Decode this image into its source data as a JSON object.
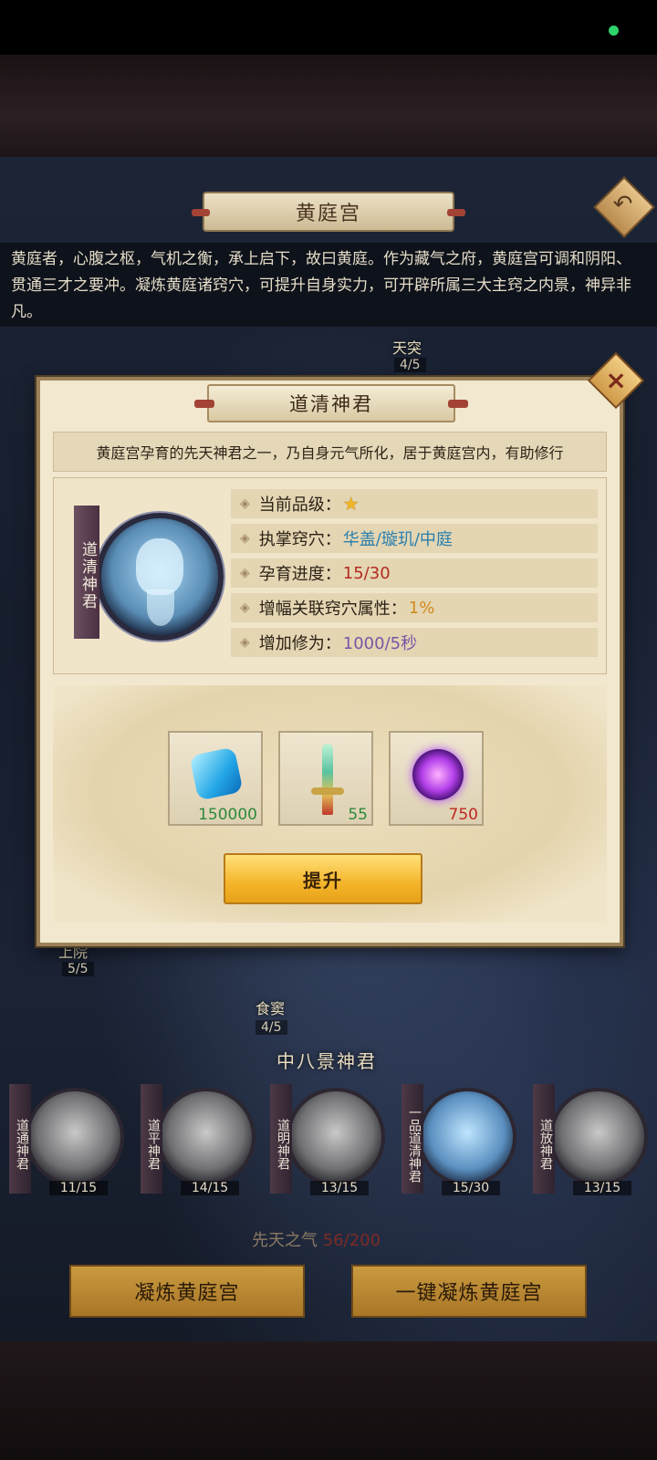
{
  "page": {
    "title": "黄庭宫",
    "description": "黄庭者，心腹之枢，气机之衡，承上启下，故曰黄庭。作为藏气之府，黄庭宫可调和阴阳、贯通三才之要冲。凝炼黄庭诸窍穴，可提升自身实力，可开辟所属三大主窍之内景，神异非凡。"
  },
  "background_nodes": [
    {
      "label": "天突",
      "count": "4/5"
    },
    {
      "label": "上院",
      "count": "5/5"
    },
    {
      "label": "食窦",
      "count": "4/5"
    }
  ],
  "dialog": {
    "title": "道清神君",
    "intro": "黄庭宫孕育的先天神君之一，乃自身元气所化，居于黄庭宫内，有助修行",
    "name_tag": "道清神君",
    "attributes": [
      {
        "label": "当前品级：",
        "value": "★",
        "color": "#f0b526"
      },
      {
        "label": "执掌窍穴：",
        "value": "华盖/璇玑/中庭",
        "color": "#2a7fae"
      },
      {
        "label": "孕育进度：",
        "value": "15/30",
        "color": "#b32a22"
      },
      {
        "label": "增幅关联窍穴属性：",
        "value": "1%",
        "color": "#d08a1c"
      },
      {
        "label": "增加修为：",
        "value": "1000/5秒",
        "color": "#7a55a6"
      }
    ],
    "costs": [
      {
        "icon": "blue-gem-icon",
        "amount": "150000",
        "color": "#2c8a3c"
      },
      {
        "icon": "sword-icon",
        "amount": "55",
        "color": "#2c8a3c"
      },
      {
        "icon": "purple-orb-icon",
        "amount": "750",
        "color": "#c0271f"
      }
    ],
    "upgrade_label": "提升"
  },
  "section_title": "中八景神君",
  "sages": [
    {
      "name": "道通神君",
      "count": "11/15",
      "blue": false
    },
    {
      "name": "道平神君",
      "count": "14/15",
      "blue": false
    },
    {
      "name": "道明神君",
      "count": "13/15",
      "blue": false
    },
    {
      "name": "一品道清神君",
      "count": "15/30",
      "blue": true
    },
    {
      "name": "道放神君",
      "count": "13/15",
      "blue": false
    }
  ],
  "qi": {
    "label": "先天之气",
    "value": "56/200"
  },
  "buttons": {
    "refine": "凝炼黄庭宫",
    "refine_all": "一键凝炼黄庭宫"
  }
}
